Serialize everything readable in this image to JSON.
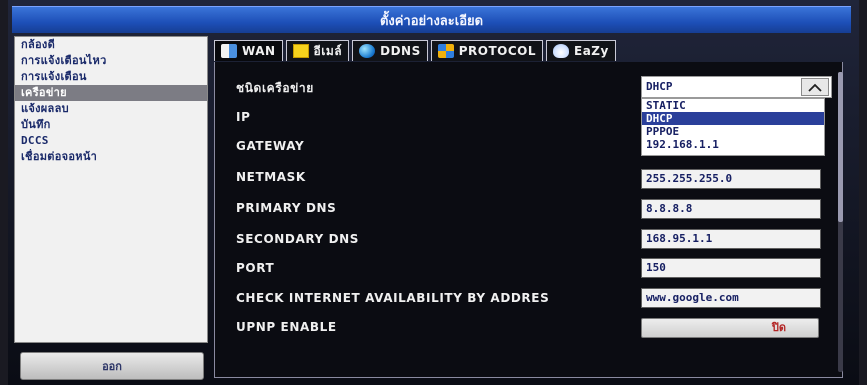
{
  "window": {
    "title": "ตั้งค่าอย่างละเอียด"
  },
  "sidebar": {
    "items": [
      {
        "label": "กล้องดี"
      },
      {
        "label": "การแจ้งเตือนไหว"
      },
      {
        "label": "การแจ้งเตือน"
      },
      {
        "label": "เครือข่าย"
      },
      {
        "label": "แจ้งผลลบ"
      },
      {
        "label": "บันทึก"
      },
      {
        "label": "DCCS"
      },
      {
        "label": "เชื่อมต่อจอหน้า"
      }
    ],
    "selected_index": 3,
    "bottom_button": "ออก"
  },
  "tabs": [
    {
      "label": "WAN",
      "icon": "monitor-icon"
    },
    {
      "label": "อีเมล์",
      "icon": "envelope-icon"
    },
    {
      "label": "DDNS",
      "icon": "globe-icon"
    },
    {
      "label": "PROTOCOL",
      "icon": "protocol-icon"
    },
    {
      "label": "EaZy",
      "icon": "cloud-icon"
    }
  ],
  "form": {
    "network_type": {
      "label": "ชนิดเครือข่าย",
      "value": "DHCP"
    },
    "ip": {
      "label": "IP"
    },
    "gateway": {
      "label": "GATEWAY"
    },
    "netmask": {
      "label": "NETMASK",
      "value": "255.255.255.0"
    },
    "primary_dns": {
      "label": "PRIMARY DNS",
      "value": "8.8.8.8"
    },
    "secondary_dns": {
      "label": "SECONDARY DNS",
      "value": "168.95.1.1"
    },
    "port": {
      "label": "PORT",
      "value": "150"
    },
    "check_internet": {
      "label": "CHECK INTERNET AVAILABILITY BY ADDRES",
      "value": "www.google.com"
    },
    "upnp": {
      "label": "UPNP ENABLE",
      "value": "ปิด"
    }
  },
  "dropdown": {
    "options": [
      "STATIC",
      "DHCP",
      "PPPOE",
      "192.168.1.1"
    ],
    "highlighted_index": 1
  }
}
